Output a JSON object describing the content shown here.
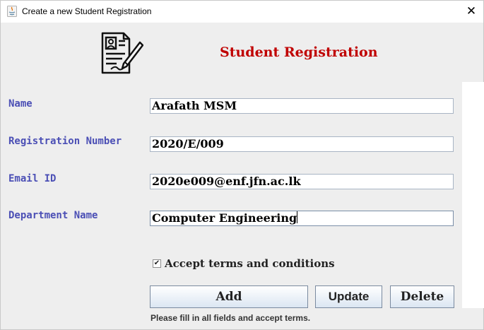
{
  "window": {
    "title": "Create a new Student Registration",
    "close_symbol": "✕",
    "app_icon": "java-icon"
  },
  "header": {
    "logo_icon": "registration-form-icon",
    "title": "Student Registration",
    "title_color": "#c00000"
  },
  "form": {
    "label_color": "#4b4fb5",
    "fields": {
      "name": {
        "label": "Name",
        "value": "Arafath MSM"
      },
      "registration_number": {
        "label": "Registration Number",
        "value": "2020/E/009"
      },
      "email": {
        "label": "Email ID",
        "value": "2020e009@enf.jfn.ac.lk"
      },
      "department": {
        "label": "Department Name",
        "value": "Computer Engineering"
      }
    },
    "terms": {
      "label": "Accept terms and conditions",
      "checked": true,
      "check_mark": "✔"
    }
  },
  "actions": {
    "add_label": "Add",
    "update_label": "Update",
    "delete_label": "Delete"
  },
  "status_message": "Please fill in all fields and accept terms."
}
